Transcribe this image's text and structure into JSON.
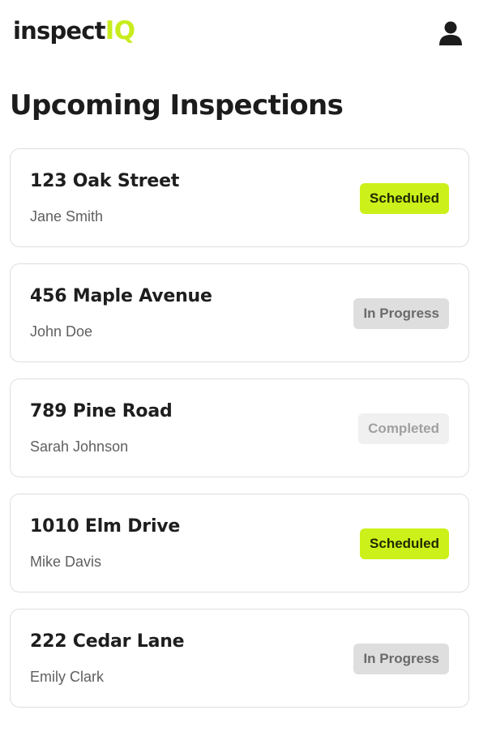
{
  "app": {
    "logo_primary": "inspect",
    "logo_accent": "IQ",
    "accent_color": "#ccf01a"
  },
  "header": {
    "user_icon": "user-icon"
  },
  "page": {
    "title": "Upcoming Inspections"
  },
  "inspections": [
    {
      "address": "123 Oak Street",
      "inspector": "Jane Smith",
      "status": "Scheduled",
      "status_key": "scheduled"
    },
    {
      "address": "456 Maple Avenue",
      "inspector": "John Doe",
      "status": "In Progress",
      "status_key": "in-progress"
    },
    {
      "address": "789 Pine Road",
      "inspector": "Sarah Johnson",
      "status": "Completed",
      "status_key": "completed"
    },
    {
      "address": "1010 Elm Drive",
      "inspector": "Mike Davis",
      "status": "Scheduled",
      "status_key": "scheduled"
    },
    {
      "address": "222 Cedar Lane",
      "inspector": "Emily Clark",
      "status": "In Progress",
      "status_key": "in-progress"
    }
  ],
  "status_colors": {
    "scheduled": "#ccf01a",
    "in-progress": "#dedede",
    "completed": "#f0f0f0"
  }
}
